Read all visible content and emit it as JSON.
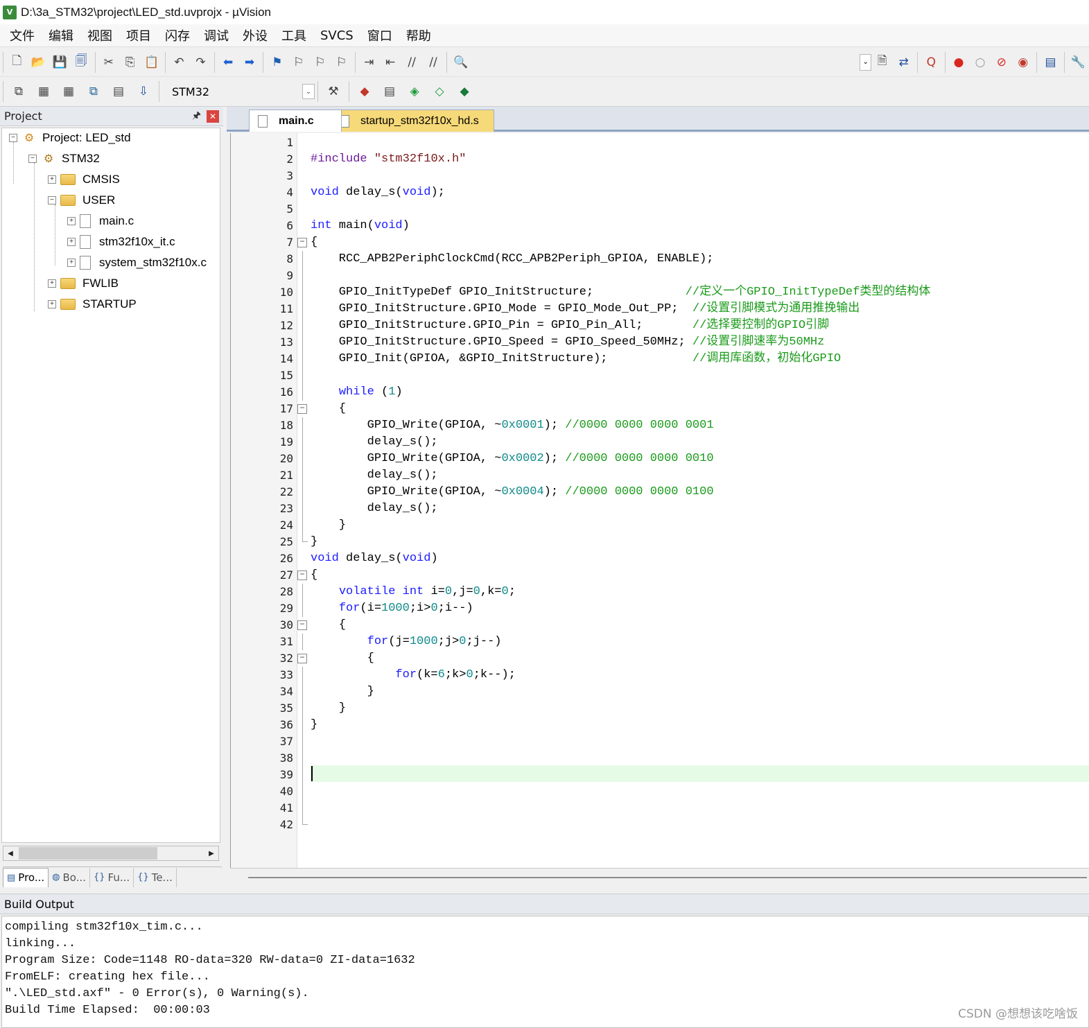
{
  "window": {
    "title": "D:\\3a_STM32\\project\\LED_std.uvprojx - µVision",
    "app_icon": "V"
  },
  "menu": [
    "文件",
    "编辑",
    "视图",
    "项目",
    "闪存",
    "调试",
    "外设",
    "工具",
    "SVCS",
    "窗口",
    "帮助"
  ],
  "toolbar1": [
    "new-file-icon",
    "open-file-icon",
    "save-icon",
    "save-all-icon",
    "|",
    "cut-icon",
    "copy-icon",
    "paste-icon",
    "|",
    "undo-icon",
    "redo-icon",
    "|",
    "nav-back-icon",
    "nav-forward-icon",
    "|",
    "bookmark-icon",
    "prev-bookmark-icon",
    "next-bookmark-icon",
    "clear-bookmarks-icon",
    "|",
    "indent-icon",
    "unindent-icon",
    "comment-icon",
    "uncomment-icon",
    "|",
    "find-in-files-icon"
  ],
  "toolbar2": {
    "target": "STM32",
    "buttons_left": [
      "translate-icon",
      "build-icon",
      "rebuild-icon",
      "batch-build-icon",
      "stop-build-icon",
      "load-icon"
    ],
    "buttons_right": [
      "target-options-icon",
      "manage-components-icon",
      "pack-installer-icon",
      "select-packs-icon",
      "event-recorder-icon",
      "run-time-env-icon"
    ]
  },
  "project_panel": {
    "title": "Project",
    "tree": [
      {
        "label": "Project: LED_std",
        "level": 0,
        "kind": "project",
        "expander": "−"
      },
      {
        "label": "STM32",
        "level": 1,
        "kind": "target",
        "expander": "−"
      },
      {
        "label": "CMSIS",
        "level": 2,
        "kind": "folder",
        "expander": "+"
      },
      {
        "label": "USER",
        "level": 2,
        "kind": "folder-open",
        "expander": "−"
      },
      {
        "label": "main.c",
        "level": 3,
        "kind": "file",
        "expander": "+"
      },
      {
        "label": "stm32f10x_it.c",
        "level": 3,
        "kind": "file",
        "expander": "+"
      },
      {
        "label": "system_stm32f10x.c",
        "level": 3,
        "kind": "file",
        "expander": "+"
      },
      {
        "label": "FWLIB",
        "level": 2,
        "kind": "folder",
        "expander": "+"
      },
      {
        "label": "STARTUP",
        "level": 2,
        "kind": "folder",
        "expander": "+"
      }
    ],
    "tabs": [
      "Pro...",
      "Bo...",
      "Fu...",
      "Te..."
    ]
  },
  "editor": {
    "tabs": [
      {
        "label": "main.c",
        "active": true
      },
      {
        "label": "startup_stm32f10x_hd.s",
        "active": false
      }
    ],
    "cursor_line": 39,
    "lines": [
      {
        "n": "1",
        "code": "",
        "fold": ""
      },
      {
        "n": "2",
        "code": "#include \"stm32f10x.h\"",
        "fold": ""
      },
      {
        "n": "3",
        "code": "",
        "fold": ""
      },
      {
        "n": "4",
        "code": "void delay_s(void);",
        "fold": ""
      },
      {
        "n": "5",
        "code": "",
        "fold": ""
      },
      {
        "n": "6",
        "code": "int main(void)",
        "fold": ""
      },
      {
        "n": "7",
        "code": "{",
        "fold": "open"
      },
      {
        "n": "8",
        "code": "    RCC_APB2PeriphClockCmd(RCC_APB2Periph_GPIOA, ENABLE);",
        "fold": "line"
      },
      {
        "n": "9",
        "code": "",
        "fold": "line"
      },
      {
        "n": "10",
        "code": "    GPIO_InitTypeDef GPIO_InitStructure;             //定义一个GPIO_InitTypeDef类型的结构体",
        "fold": "line"
      },
      {
        "n": "11",
        "code": "    GPIO_InitStructure.GPIO_Mode = GPIO_Mode_Out_PP;  //设置引脚模式为通用推挽输出",
        "fold": "line"
      },
      {
        "n": "12",
        "code": "    GPIO_InitStructure.GPIO_Pin = GPIO_Pin_All;       //选择要控制的GPIO引脚",
        "fold": "line"
      },
      {
        "n": "13",
        "code": "    GPIO_InitStructure.GPIO_Speed = GPIO_Speed_50MHz; //设置引脚速率为50MHz",
        "fold": "line"
      },
      {
        "n": "14",
        "code": "    GPIO_Init(GPIOA, &GPIO_InitStructure);            //调用库函数，初始化GPIO",
        "fold": "line"
      },
      {
        "n": "15",
        "code": "",
        "fold": "line"
      },
      {
        "n": "16",
        "code": "    while (1)",
        "fold": "line"
      },
      {
        "n": "17",
        "code": "    {",
        "fold": "open"
      },
      {
        "n": "18",
        "code": "        GPIO_Write(GPIOA, ~0x0001); //0000 0000 0000 0001",
        "fold": "line"
      },
      {
        "n": "19",
        "code": "        delay_s();",
        "fold": "line"
      },
      {
        "n": "20",
        "code": "        GPIO_Write(GPIOA, ~0x0002); //0000 0000 0000 0010",
        "fold": "line"
      },
      {
        "n": "21",
        "code": "        delay_s();",
        "fold": "line"
      },
      {
        "n": "22",
        "code": "        GPIO_Write(GPIOA, ~0x0004); //0000 0000 0000 0100",
        "fold": "line"
      },
      {
        "n": "23",
        "code": "        delay_s();",
        "fold": "line"
      },
      {
        "n": "24",
        "code": "    }",
        "fold": "line"
      },
      {
        "n": "25",
        "code": "}",
        "fold": "end"
      },
      {
        "n": "26",
        "code": "void delay_s(void)",
        "fold": ""
      },
      {
        "n": "27",
        "code": "{",
        "fold": "open"
      },
      {
        "n": "28",
        "code": "    volatile int i=0,j=0,k=0;",
        "fold": "line"
      },
      {
        "n": "29",
        "code": "    for(i=1000;i>0;i--)",
        "fold": "line"
      },
      {
        "n": "30",
        "code": "    {",
        "fold": "open"
      },
      {
        "n": "31",
        "code": "        for(j=1000;j>0;j--)",
        "fold": "line"
      },
      {
        "n": "32",
        "code": "        {",
        "fold": "open"
      },
      {
        "n": "33",
        "code": "            for(k=6;k>0;k--);",
        "fold": "line"
      },
      {
        "n": "34",
        "code": "        }",
        "fold": "line"
      },
      {
        "n": "35",
        "code": "    }",
        "fold": "line"
      },
      {
        "n": "36",
        "code": "}",
        "fold": "line"
      },
      {
        "n": "37",
        "code": "",
        "fold": "line"
      },
      {
        "n": "38",
        "code": "",
        "fold": "line"
      },
      {
        "n": "39",
        "code": "",
        "fold": "line"
      },
      {
        "n": "40",
        "code": "",
        "fold": "line"
      },
      {
        "n": "41",
        "code": "",
        "fold": "line"
      },
      {
        "n": "42",
        "code": "",
        "fold": "end"
      }
    ]
  },
  "build_output": {
    "title": "Build Output",
    "lines": [
      "compiling stm32f10x_tim.c...",
      "linking...",
      "Program Size: Code=1148 RO-data=320 RW-data=0 ZI-data=1632",
      "FromELF: creating hex file...",
      "\".\\LED_std.axf\" - 0 Error(s), 0 Warning(s).",
      "Build Time Elapsed:  00:00:03"
    ]
  },
  "watermark": "CSDN @想想该吃啥饭",
  "colors": {
    "keyword": "#1c1cff",
    "comment": "#1a9a1a",
    "number": "#0f8a8a",
    "string": "#7a1a1a",
    "cursor_line_bg": "#e6fbe6",
    "inactive_tab_bg": "#f6d979"
  }
}
